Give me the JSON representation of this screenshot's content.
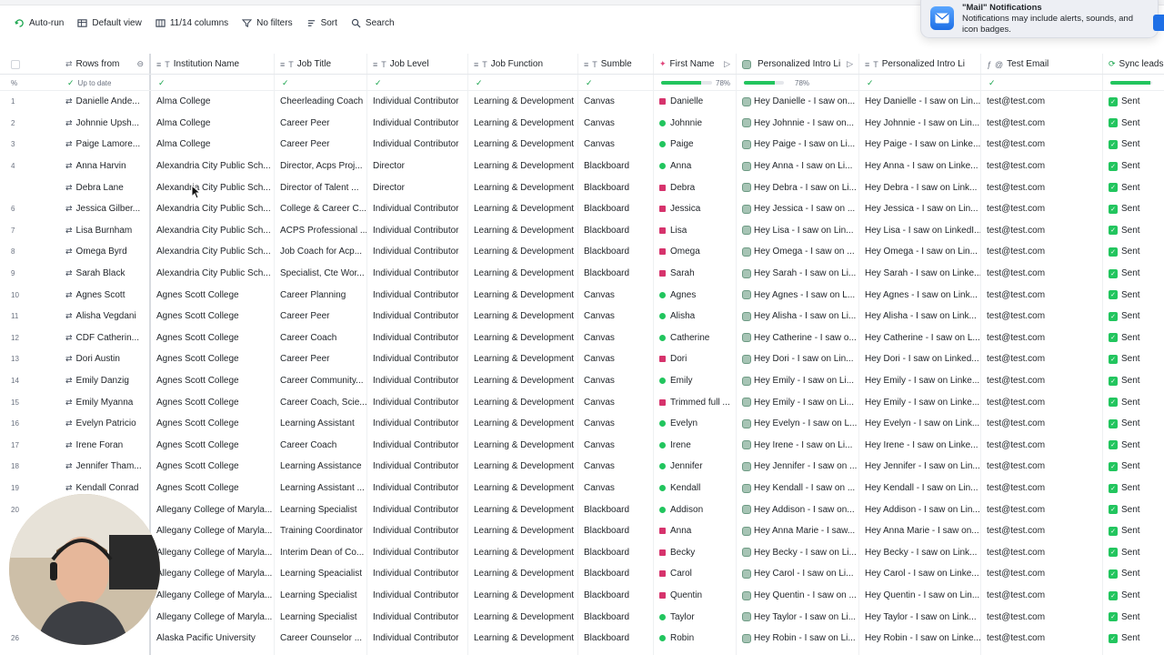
{
  "toolbar": {
    "autorun": "Auto-run",
    "view": "Default view",
    "columns": "11/14 columns",
    "filters": "No filters",
    "sort": "Sort",
    "search": "Search"
  },
  "notification": {
    "title": "\"Mail\" Notifications",
    "body": "Notifications may include alerts, sounds, and icon badges."
  },
  "columns": {
    "rows_from": "Rows from",
    "institution": "Institution Name",
    "job_title": "Job Title",
    "job_level": "Job Level",
    "job_function": "Job Function",
    "lms": "Sumble",
    "first_name": "First Name",
    "intro1": "Personalized Intro Li",
    "intro2": "Personalized Intro Li",
    "test_email": "Test Email",
    "sync": "Sync leads"
  },
  "status_row": {
    "percent_symbol": "%",
    "up_to_date": "Up to date",
    "first_name_pct": "78%",
    "intro1_pct": "78%",
    "first_name_fill": 0.78,
    "intro1_fill": 0.78,
    "sync_fill": 0.95
  },
  "colors": {
    "green": "#22c55e",
    "pink": "#d6336c",
    "accent": "#16a34a"
  },
  "rows": [
    {
      "n": "1",
      "name": "Danielle Ande...",
      "inst": "Alma College",
      "title": "Cheerleading Coach",
      "level": "Individual Contributor",
      "func": "Learning & Development",
      "lms": "Canvas",
      "first": "Danielle",
      "fn_mark": "square",
      "intro1": "Hey Danielle - I saw on...",
      "intro2": "Hey Danielle - I saw on Lin...",
      "email": "test@test.com",
      "sync": "Sent"
    },
    {
      "n": "2",
      "name": "Johnnie Upsh...",
      "inst": "Alma College",
      "title": "Career Peer",
      "level": "Individual Contributor",
      "func": "Learning & Development",
      "lms": "Canvas",
      "first": "Johnnie",
      "fn_mark": "circle",
      "intro1": "Hey Johnnie - I saw on...",
      "intro2": "Hey Johnnie - I saw on Lin...",
      "email": "test@test.com",
      "sync": "Sent"
    },
    {
      "n": "3",
      "name": "Paige Lamore...",
      "inst": "Alma College",
      "title": "Career Peer",
      "level": "Individual Contributor",
      "func": "Learning & Development",
      "lms": "Canvas",
      "first": "Paige",
      "fn_mark": "circle",
      "intro1": "Hey Paige - I saw on Li...",
      "intro2": "Hey Paige - I saw on Linke...",
      "email": "test@test.com",
      "sync": "Sent"
    },
    {
      "n": "4",
      "name": "Anna Harvin",
      "inst": "Alexandria City Public Sch...",
      "title": "Director, Acps Proj...",
      "level": "Director",
      "func": "Learning & Development",
      "lms": "Blackboard",
      "first": "Anna",
      "fn_mark": "circle",
      "intro1": "Hey Anna - I saw on Li...",
      "intro2": "Hey Anna - I saw on Linke...",
      "email": "test@test.com",
      "sync": "Sent"
    },
    {
      "n": "",
      "name": "Debra Lane",
      "inst": "Alexandria City Public Sch...",
      "title": "Director of Talent ...",
      "level": "Director",
      "func": "Learning & Development",
      "lms": "Blackboard",
      "first": "Debra",
      "fn_mark": "square",
      "intro1": "Hey Debra - I saw on Li...",
      "intro2": "Hey Debra - I saw on Link...",
      "email": "test@test.com",
      "sync": "Sent"
    },
    {
      "n": "6",
      "name": "Jessica Gilber...",
      "inst": "Alexandria City Public Sch...",
      "title": "College & Career C...",
      "level": "Individual Contributor",
      "func": "Learning & Development",
      "lms": "Blackboard",
      "first": "Jessica",
      "fn_mark": "square",
      "intro1": "Hey Jessica - I saw on ...",
      "intro2": "Hey Jessica - I saw on Lin...",
      "email": "test@test.com",
      "sync": "Sent"
    },
    {
      "n": "7",
      "name": "Lisa Burnham",
      "inst": "Alexandria City Public Sch...",
      "title": "ACPS Professional ...",
      "level": "Individual Contributor",
      "func": "Learning & Development",
      "lms": "Blackboard",
      "first": "Lisa",
      "fn_mark": "square",
      "intro1": "Hey Lisa - I saw on Lin...",
      "intro2": "Hey Lisa - I saw on LinkedI...",
      "email": "test@test.com",
      "sync": "Sent"
    },
    {
      "n": "8",
      "name": "Omega Byrd",
      "inst": "Alexandria City Public Sch...",
      "title": "Job Coach for Acp...",
      "level": "Individual Contributor",
      "func": "Learning & Development",
      "lms": "Blackboard",
      "first": "Omega",
      "fn_mark": "square",
      "intro1": "Hey Omega - I saw on ...",
      "intro2": "Hey Omega - I saw on Lin...",
      "email": "test@test.com",
      "sync": "Sent"
    },
    {
      "n": "9",
      "name": "Sarah Black",
      "inst": "Alexandria City Public Sch...",
      "title": "Specialist, Cte Wor...",
      "level": "Individual Contributor",
      "func": "Learning & Development",
      "lms": "Blackboard",
      "first": "Sarah",
      "fn_mark": "square",
      "intro1": "Hey Sarah - I saw on Li...",
      "intro2": "Hey Sarah - I saw on Linke...",
      "email": "test@test.com",
      "sync": "Sent"
    },
    {
      "n": "10",
      "name": "Agnes Scott",
      "inst": "Agnes Scott College",
      "title": "Career Planning",
      "level": "Individual Contributor",
      "func": "Learning & Development",
      "lms": "Canvas",
      "first": "Agnes",
      "fn_mark": "circle",
      "intro1": "Hey Agnes - I saw on L...",
      "intro2": "Hey Agnes - I saw on Link...",
      "email": "test@test.com",
      "sync": "Sent"
    },
    {
      "n": "11",
      "name": "Alisha Vegdani",
      "inst": "Agnes Scott College",
      "title": "Career Peer",
      "level": "Individual Contributor",
      "func": "Learning & Development",
      "lms": "Canvas",
      "first": "Alisha",
      "fn_mark": "circle",
      "intro1": "Hey Alisha - I saw on Li...",
      "intro2": "Hey Alisha - I saw on Link...",
      "email": "test@test.com",
      "sync": "Sent"
    },
    {
      "n": "12",
      "name": "CDF Catherin...",
      "inst": "Agnes Scott College",
      "title": "Career Coach",
      "level": "Individual Contributor",
      "func": "Learning & Development",
      "lms": "Canvas",
      "first": "Catherine",
      "fn_mark": "circle",
      "intro1": "Hey Catherine - I saw o...",
      "intro2": "Hey Catherine - I saw on L...",
      "email": "test@test.com",
      "sync": "Sent"
    },
    {
      "n": "13",
      "name": "Dori Austin",
      "inst": "Agnes Scott College",
      "title": "Career Peer",
      "level": "Individual Contributor",
      "func": "Learning & Development",
      "lms": "Canvas",
      "first": "Dori",
      "fn_mark": "square",
      "intro1": "Hey Dori - I saw on Lin...",
      "intro2": "Hey Dori - I saw on Linked...",
      "email": "test@test.com",
      "sync": "Sent"
    },
    {
      "n": "14",
      "name": "Emily Danzig",
      "inst": "Agnes Scott College",
      "title": "Career Community...",
      "level": "Individual Contributor",
      "func": "Learning & Development",
      "lms": "Canvas",
      "first": "Emily",
      "fn_mark": "circle",
      "intro1": "Hey Emily - I saw on Li...",
      "intro2": "Hey Emily - I saw on Linke...",
      "email": "test@test.com",
      "sync": "Sent"
    },
    {
      "n": "15",
      "name": "Emily Myanna",
      "inst": "Agnes Scott College",
      "title": "Career Coach, Scie...",
      "level": "Individual Contributor",
      "func": "Learning & Development",
      "lms": "Canvas",
      "first": "Trimmed full ...",
      "fn_mark": "square",
      "intro1": "Hey Emily - I saw on Li...",
      "intro2": "Hey Emily - I saw on Linke...",
      "email": "test@test.com",
      "sync": "Sent"
    },
    {
      "n": "16",
      "name": "Evelyn Patricio",
      "inst": "Agnes Scott College",
      "title": "Learning Assistant",
      "level": "Individual Contributor",
      "func": "Learning & Development",
      "lms": "Canvas",
      "first": "Evelyn",
      "fn_mark": "circle",
      "intro1": "Hey Evelyn - I saw on L...",
      "intro2": "Hey Evelyn - I saw on Link...",
      "email": "test@test.com",
      "sync": "Sent"
    },
    {
      "n": "17",
      "name": "Irene Foran",
      "inst": "Agnes Scott College",
      "title": "Career Coach",
      "level": "Individual Contributor",
      "func": "Learning & Development",
      "lms": "Canvas",
      "first": "Irene",
      "fn_mark": "circle",
      "intro1": "Hey Irene - I saw on Li...",
      "intro2": "Hey Irene - I saw on Linke...",
      "email": "test@test.com",
      "sync": "Sent"
    },
    {
      "n": "18",
      "name": "Jennifer Tham...",
      "inst": "Agnes Scott College",
      "title": "Learning Assistance",
      "level": "Individual Contributor",
      "func": "Learning & Development",
      "lms": "Canvas",
      "first": "Jennifer",
      "fn_mark": "circle",
      "intro1": "Hey Jennifer - I saw on ...",
      "intro2": "Hey Jennifer - I saw on Lin...",
      "email": "test@test.com",
      "sync": "Sent"
    },
    {
      "n": "19",
      "name": "Kendall Conrad",
      "inst": "Agnes Scott College",
      "title": "Learning Assistant ...",
      "level": "Individual Contributor",
      "func": "Learning & Development",
      "lms": "Canvas",
      "first": "Kendall",
      "fn_mark": "circle",
      "intro1": "Hey Kendall - I saw on ...",
      "intro2": "Hey Kendall - I saw on Lin...",
      "email": "test@test.com",
      "sync": "Sent"
    },
    {
      "n": "20",
      "name": "",
      "inst": "Allegany College of Maryla...",
      "title": "Learning Specialist",
      "level": "Individual Contributor",
      "func": "Learning & Development",
      "lms": "Blackboard",
      "first": "Addison",
      "fn_mark": "circle",
      "intro1": "Hey Addison - I saw on...",
      "intro2": "Hey Addison - I saw on Lin...",
      "email": "test@test.com",
      "sync": "Sent"
    },
    {
      "n": "",
      "name": "",
      "inst": "Allegany College of Maryla...",
      "title": "Training Coordinator",
      "level": "Individual Contributor",
      "func": "Learning & Development",
      "lms": "Blackboard",
      "first": "Anna",
      "fn_mark": "square",
      "intro1": "Hey Anna Marie - I saw...",
      "intro2": "Hey Anna Marie - I saw on...",
      "email": "test@test.com",
      "sync": "Sent"
    },
    {
      "n": "",
      "name": "",
      "inst": "Allegany College of Maryla...",
      "title": "Interim Dean of Co...",
      "level": "Individual Contributor",
      "func": "Learning & Development",
      "lms": "Blackboard",
      "first": "Becky",
      "fn_mark": "square",
      "intro1": "Hey Becky - I saw on Li...",
      "intro2": "Hey Becky - I saw on Link...",
      "email": "test@test.com",
      "sync": "Sent"
    },
    {
      "n": "",
      "name": "",
      "inst": "Allegany College of Maryla...",
      "title": "Learning Speacialist",
      "level": "Individual Contributor",
      "func": "Learning & Development",
      "lms": "Blackboard",
      "first": "Carol",
      "fn_mark": "square",
      "intro1": "Hey Carol - I saw on Li...",
      "intro2": "Hey Carol - I saw on Linke...",
      "email": "test@test.com",
      "sync": "Sent"
    },
    {
      "n": "",
      "name": "",
      "inst": "Allegany College of Maryla...",
      "title": "Learning Specialist",
      "level": "Individual Contributor",
      "func": "Learning & Development",
      "lms": "Blackboard",
      "first": "Quentin",
      "fn_mark": "square",
      "intro1": "Hey Quentin - I saw on ...",
      "intro2": "Hey Quentin - I saw on Lin...",
      "email": "test@test.com",
      "sync": "Sent"
    },
    {
      "n": "",
      "name": "",
      "inst": "Allegany College of Maryla...",
      "title": "Learning Specialist",
      "level": "Individual Contributor",
      "func": "Learning & Development",
      "lms": "Blackboard",
      "first": "Taylor",
      "fn_mark": "circle",
      "intro1": "Hey Taylor - I saw on Li...",
      "intro2": "Hey Taylor - I saw on Link...",
      "email": "test@test.com",
      "sync": "Sent"
    },
    {
      "n": "26",
      "name": "",
      "inst": "Alaska Pacific University",
      "title": "Career Counselor ...",
      "level": "Individual Contributor",
      "func": "Learning & Development",
      "lms": "Blackboard",
      "first": "Robin",
      "fn_mark": "circle",
      "intro1": "Hey Robin - I saw on Li...",
      "intro2": "Hey Robin - I saw on Linke...",
      "email": "test@test.com",
      "sync": "Sent"
    }
  ]
}
